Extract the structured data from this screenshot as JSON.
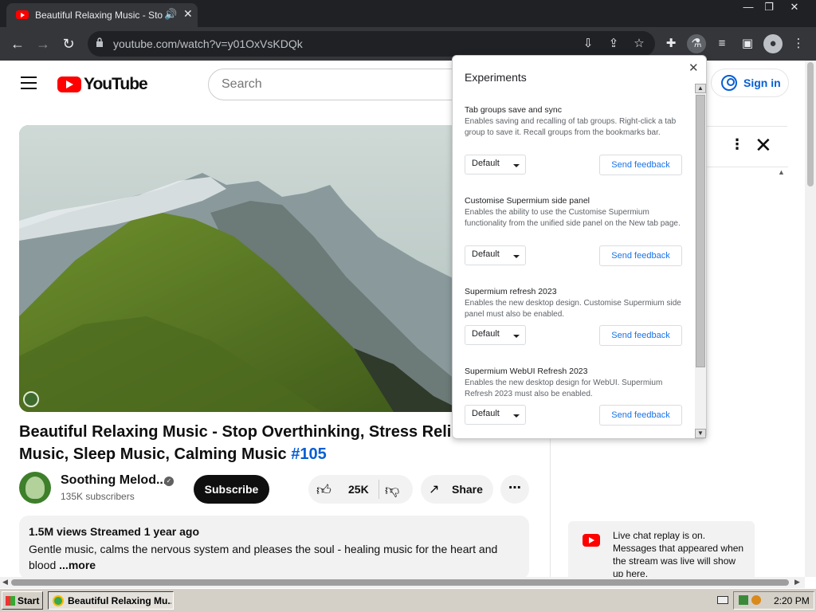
{
  "browser": {
    "tab_title": "Beautiful Relaxing Music - Stop",
    "url": "youtube.com/watch?v=y01OxVsKDQk",
    "window_controls": [
      "—",
      "❐",
      "✕"
    ]
  },
  "youtube": {
    "logo_text": "YouTube",
    "search_placeholder": "Search",
    "signin_label": "Sign in",
    "video_title": "Beautiful Relaxing Music - Stop Overthinking, Stress Relief Music, Sleep Music, Calming Music",
    "video_tag": "#105",
    "channel_name": "Soothing Melod...",
    "subscribers": "135K subscribers",
    "subscribe_label": "Subscribe",
    "like_count": "25K",
    "share_label": "Share",
    "description": {
      "meta": "1.5M views  Streamed 1 year ago",
      "text": "Gentle music, calms the nervous system and pleases the soul - healing music for the heart and blood",
      "more": "...more"
    },
    "live_chat_text": "Live chat replay is on. Messages that appeared when the stream was live will show up here."
  },
  "experiments": {
    "header": "Experiments",
    "items": [
      {
        "title": "Tab groups save and sync",
        "description": "Enables saving and recalling of tab groups. Right-click a tab group to save it. Recall groups from the bookmarks bar.",
        "value": "Default",
        "feedback": "Send feedback"
      },
      {
        "title": "Customise Supermium side panel",
        "description": "Enables the ability to use the Customise Supermium functionality from the unified side panel on the New tab page.",
        "value": "Default",
        "feedback": "Send feedback"
      },
      {
        "title": "Supermium refresh 2023",
        "description": "Enables the new desktop design. Customise Supermium side panel must also be enabled.",
        "value": "Default",
        "feedback": "Send feedback"
      },
      {
        "title": "Supermium WebUI Refresh 2023",
        "description": "Enables the new desktop design for WebUI. Supermium Refresh 2023 must also be enabled.",
        "value": "Default",
        "feedback": "Send feedback"
      }
    ]
  },
  "taskbar": {
    "start_label": "Start",
    "task_label": "Beautiful Relaxing Mu...",
    "clock": "2:20 PM"
  }
}
